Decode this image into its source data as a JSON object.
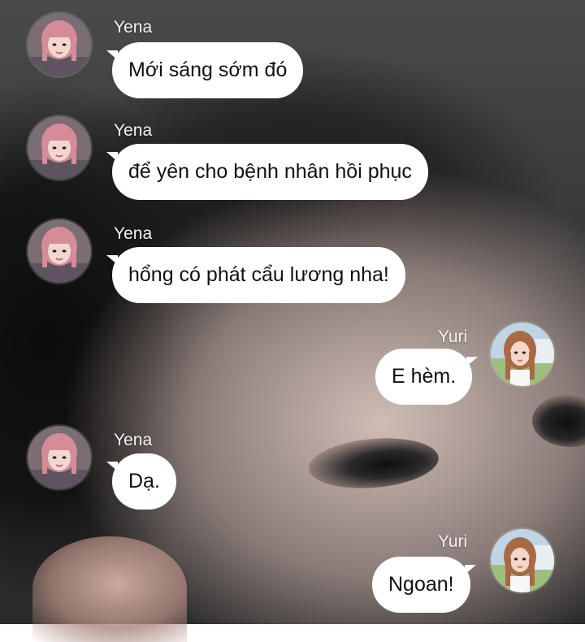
{
  "chat": {
    "messages": [
      {
        "sender": "Yena",
        "text": "Mới sáng sớm đó",
        "side": "left"
      },
      {
        "sender": "Yena",
        "text": "để yên cho bệnh nhân hồi phục",
        "side": "left"
      },
      {
        "sender": "Yena",
        "text": "hổng có phát cẩu lương nha!",
        "side": "left"
      },
      {
        "sender": "Yuri",
        "text": "E hèm.",
        "side": "right"
      },
      {
        "sender": "Yena",
        "text": "Dạ.",
        "side": "left"
      },
      {
        "sender": "Yuri",
        "text": "Ngoan!",
        "side": "right"
      }
    ]
  },
  "colors": {
    "bubble_bg": "#ffffff",
    "bubble_text": "#111111",
    "name_text": "#f2f2f2",
    "yena_hair": "#d58b98",
    "yuri_hair": "#a86a45"
  },
  "icons": {
    "yena_avatar": "yena-avatar-icon",
    "yuri_avatar": "yuri-avatar-icon"
  }
}
